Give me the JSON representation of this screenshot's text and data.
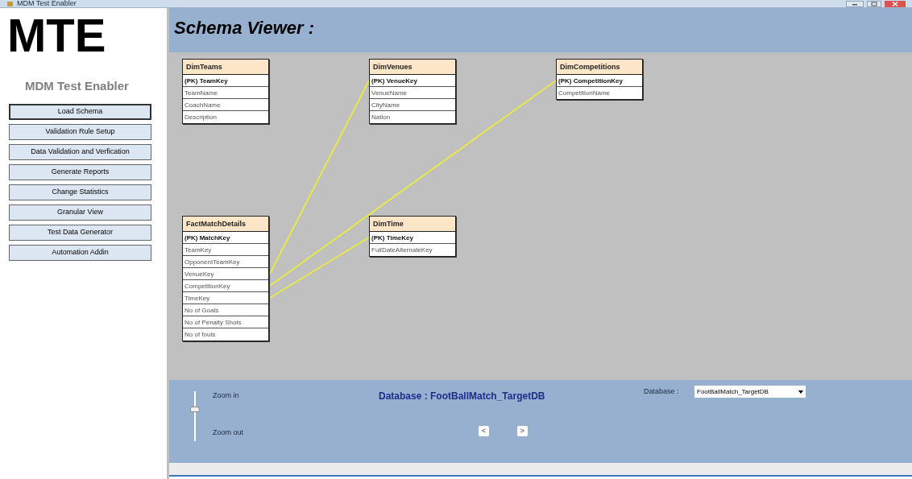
{
  "window": {
    "title": "MDM Test Enabler"
  },
  "sidebar": {
    "logo": "MTE",
    "subtitle": "MDM Test Enabler",
    "items": [
      {
        "label": "Load Schema",
        "selected": true
      },
      {
        "label": "Validation Rule Setup",
        "selected": false
      },
      {
        "label": "Data Validation and Verfication",
        "selected": false
      },
      {
        "label": "Generate Reports",
        "selected": false
      },
      {
        "label": "Change Statistics",
        "selected": false
      },
      {
        "label": "Granular View",
        "selected": false
      },
      {
        "label": "Test Data Generator",
        "selected": false
      },
      {
        "label": "Automation Addin",
        "selected": false
      }
    ]
  },
  "header": {
    "title": "Schema Viewer :"
  },
  "tables": [
    {
      "name": "DimTeams",
      "columns": [
        {
          "label": "(PK) TeamKey",
          "primary": true
        },
        {
          "label": "TeamName",
          "primary": false
        },
        {
          "label": "CoachName",
          "primary": false
        },
        {
          "label": "Description",
          "primary": false
        }
      ]
    },
    {
      "name": "DimVenues",
      "columns": [
        {
          "label": "(PK) VenueKey",
          "primary": true
        },
        {
          "label": "VenueName",
          "primary": false
        },
        {
          "label": "CityName",
          "primary": false
        },
        {
          "label": "Nation",
          "primary": false
        }
      ]
    },
    {
      "name": "DimCompetitions",
      "columns": [
        {
          "label": "(PK) CompetitionKey",
          "primary": true
        },
        {
          "label": "CompetitionName",
          "primary": false
        }
      ]
    },
    {
      "name": "FactMatchDetails",
      "columns": [
        {
          "label": "(PK) MatchKey",
          "primary": true
        },
        {
          "label": "TeamKey",
          "primary": false
        },
        {
          "label": "OpponentTeamKey",
          "primary": false
        },
        {
          "label": "VenueKey",
          "primary": false
        },
        {
          "label": "CompetitionKey",
          "primary": false
        },
        {
          "label": "TimeKey",
          "primary": false
        },
        {
          "label": "No of Goals",
          "primary": false
        },
        {
          "label": "No of Penalty Shots",
          "primary": false
        },
        {
          "label": "No of fouls",
          "primary": false
        }
      ]
    },
    {
      "name": "DimTime",
      "columns": [
        {
          "label": "(PK) TimeKey",
          "primary": true
        },
        {
          "label": "FullDateAlternateKey",
          "primary": false
        }
      ]
    }
  ],
  "footer": {
    "zoom_in": "Zoom in",
    "zoom_out": "Zoom out",
    "zoom": {
      "level": 0.65
    },
    "database_caption": "Database : FootBallMatch_TargetDB",
    "prev": "<",
    "next": ">",
    "database_label": "Database :",
    "database_value": "FootBallMatch_TargetDB"
  }
}
